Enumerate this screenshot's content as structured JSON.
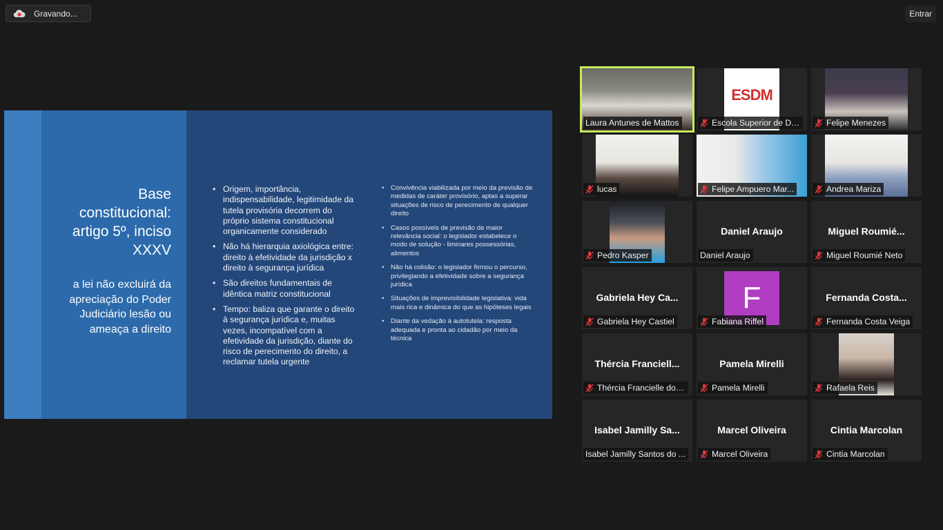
{
  "topbar": {
    "recording_label": "Gravando...",
    "enter_button": "Entrar"
  },
  "slide": {
    "title": "Base constitucional: artigo 5º, inciso XXXV",
    "subtitle": "a lei não excluirá da apreciação do Poder Judiciário lesão ou ameaça a direito",
    "left_bullets": [
      "Origem, importância, indispensabilidade, legitimidade da tutela provisória decorrem do próprio sistema constitucional organicamente considerado",
      "Não há hierarquia axiológica entre: direito à efetividade da jurisdição x direito à segurança jurídica",
      "São direitos fundamentais de idêntica matriz constitucional",
      "Tempo: baliza que garante o direito à segurança jurídica e, muitas vezes, incompatível com a efetividade da jurisdição, diante do risco de perecimento do direito, a reclamar tutela urgente"
    ],
    "right_bullets": [
      "Convivência viabilizada por meio da previsão de medidas de caráter provisório, aptas a superar situações de risco de perecimento de qualquer direito",
      "Casos possíveis de previsão de maior relevância social: o legislador estabelece o modo de solução - liminares possessórias, alimentos",
      "Não há colisão: o legislador firmou o percurso, privilegiando a efetividade sobre a segurança jurídica",
      "Situações de imprevisibilidade legislativa: vida mais rica e dinâmica do que as hipóteses legais",
      "Diante da vedação à autotutela: resposta adequada e pronta ao cidadão por meio da técnica"
    ]
  },
  "participants": [
    {
      "label": "Laura Antunes de Mattos",
      "muted": false,
      "type": "video",
      "active": true
    },
    {
      "label": "Escola Superior de Di...",
      "muted": true,
      "type": "logo",
      "logo_text": "ESDM"
    },
    {
      "label": "Felipe Menezes",
      "muted": true,
      "type": "video"
    },
    {
      "label": "lucas",
      "muted": true,
      "type": "video"
    },
    {
      "label": "Felipe Ampuero Mar...",
      "muted": true,
      "type": "video"
    },
    {
      "label": "Andrea Mariza",
      "muted": true,
      "type": "video"
    },
    {
      "label": "Pedro Kasper",
      "muted": true,
      "type": "video"
    },
    {
      "label": "Daniel Araujo",
      "muted": false,
      "type": "name",
      "big": "Daniel Araujo"
    },
    {
      "label": "Miguel Roumié Neto",
      "muted": true,
      "type": "name",
      "big": "Miguel  Roumié..."
    },
    {
      "label": "Gabriela Hey Castiel",
      "muted": true,
      "type": "name",
      "big": "Gabriela  Hey  Ca..."
    },
    {
      "label": "Fabiana Riffel",
      "muted": true,
      "type": "avatar",
      "initial": "F"
    },
    {
      "label": "Fernanda Costa Veiga",
      "muted": true,
      "type": "name",
      "big": "Fernanda  Costa..."
    },
    {
      "label": "Thércia Francielle dos...",
      "muted": true,
      "type": "name",
      "big": "Thércia  Franciell..."
    },
    {
      "label": "Pamela Mirelli",
      "muted": true,
      "type": "name",
      "big": "Pamela Mirelli"
    },
    {
      "label": "Rafaela Reis",
      "muted": true,
      "type": "video"
    },
    {
      "label": "Isabel Jamilly Santos do ...",
      "muted": false,
      "type": "name",
      "big": "Isabel  Jamilly  Sa..."
    },
    {
      "label": "Marcel Oliveira",
      "muted": true,
      "type": "name",
      "big": "Marcel Oliveira"
    },
    {
      "label": "Cintia Marcolan",
      "muted": true,
      "type": "name",
      "big": "Cintia Marcolan"
    }
  ],
  "colors": {
    "active_speaker": "#c6ec5a",
    "mute_red": "#e0393b",
    "slide_bg": "#24477a",
    "avatar_purple": "#b13ec2"
  }
}
